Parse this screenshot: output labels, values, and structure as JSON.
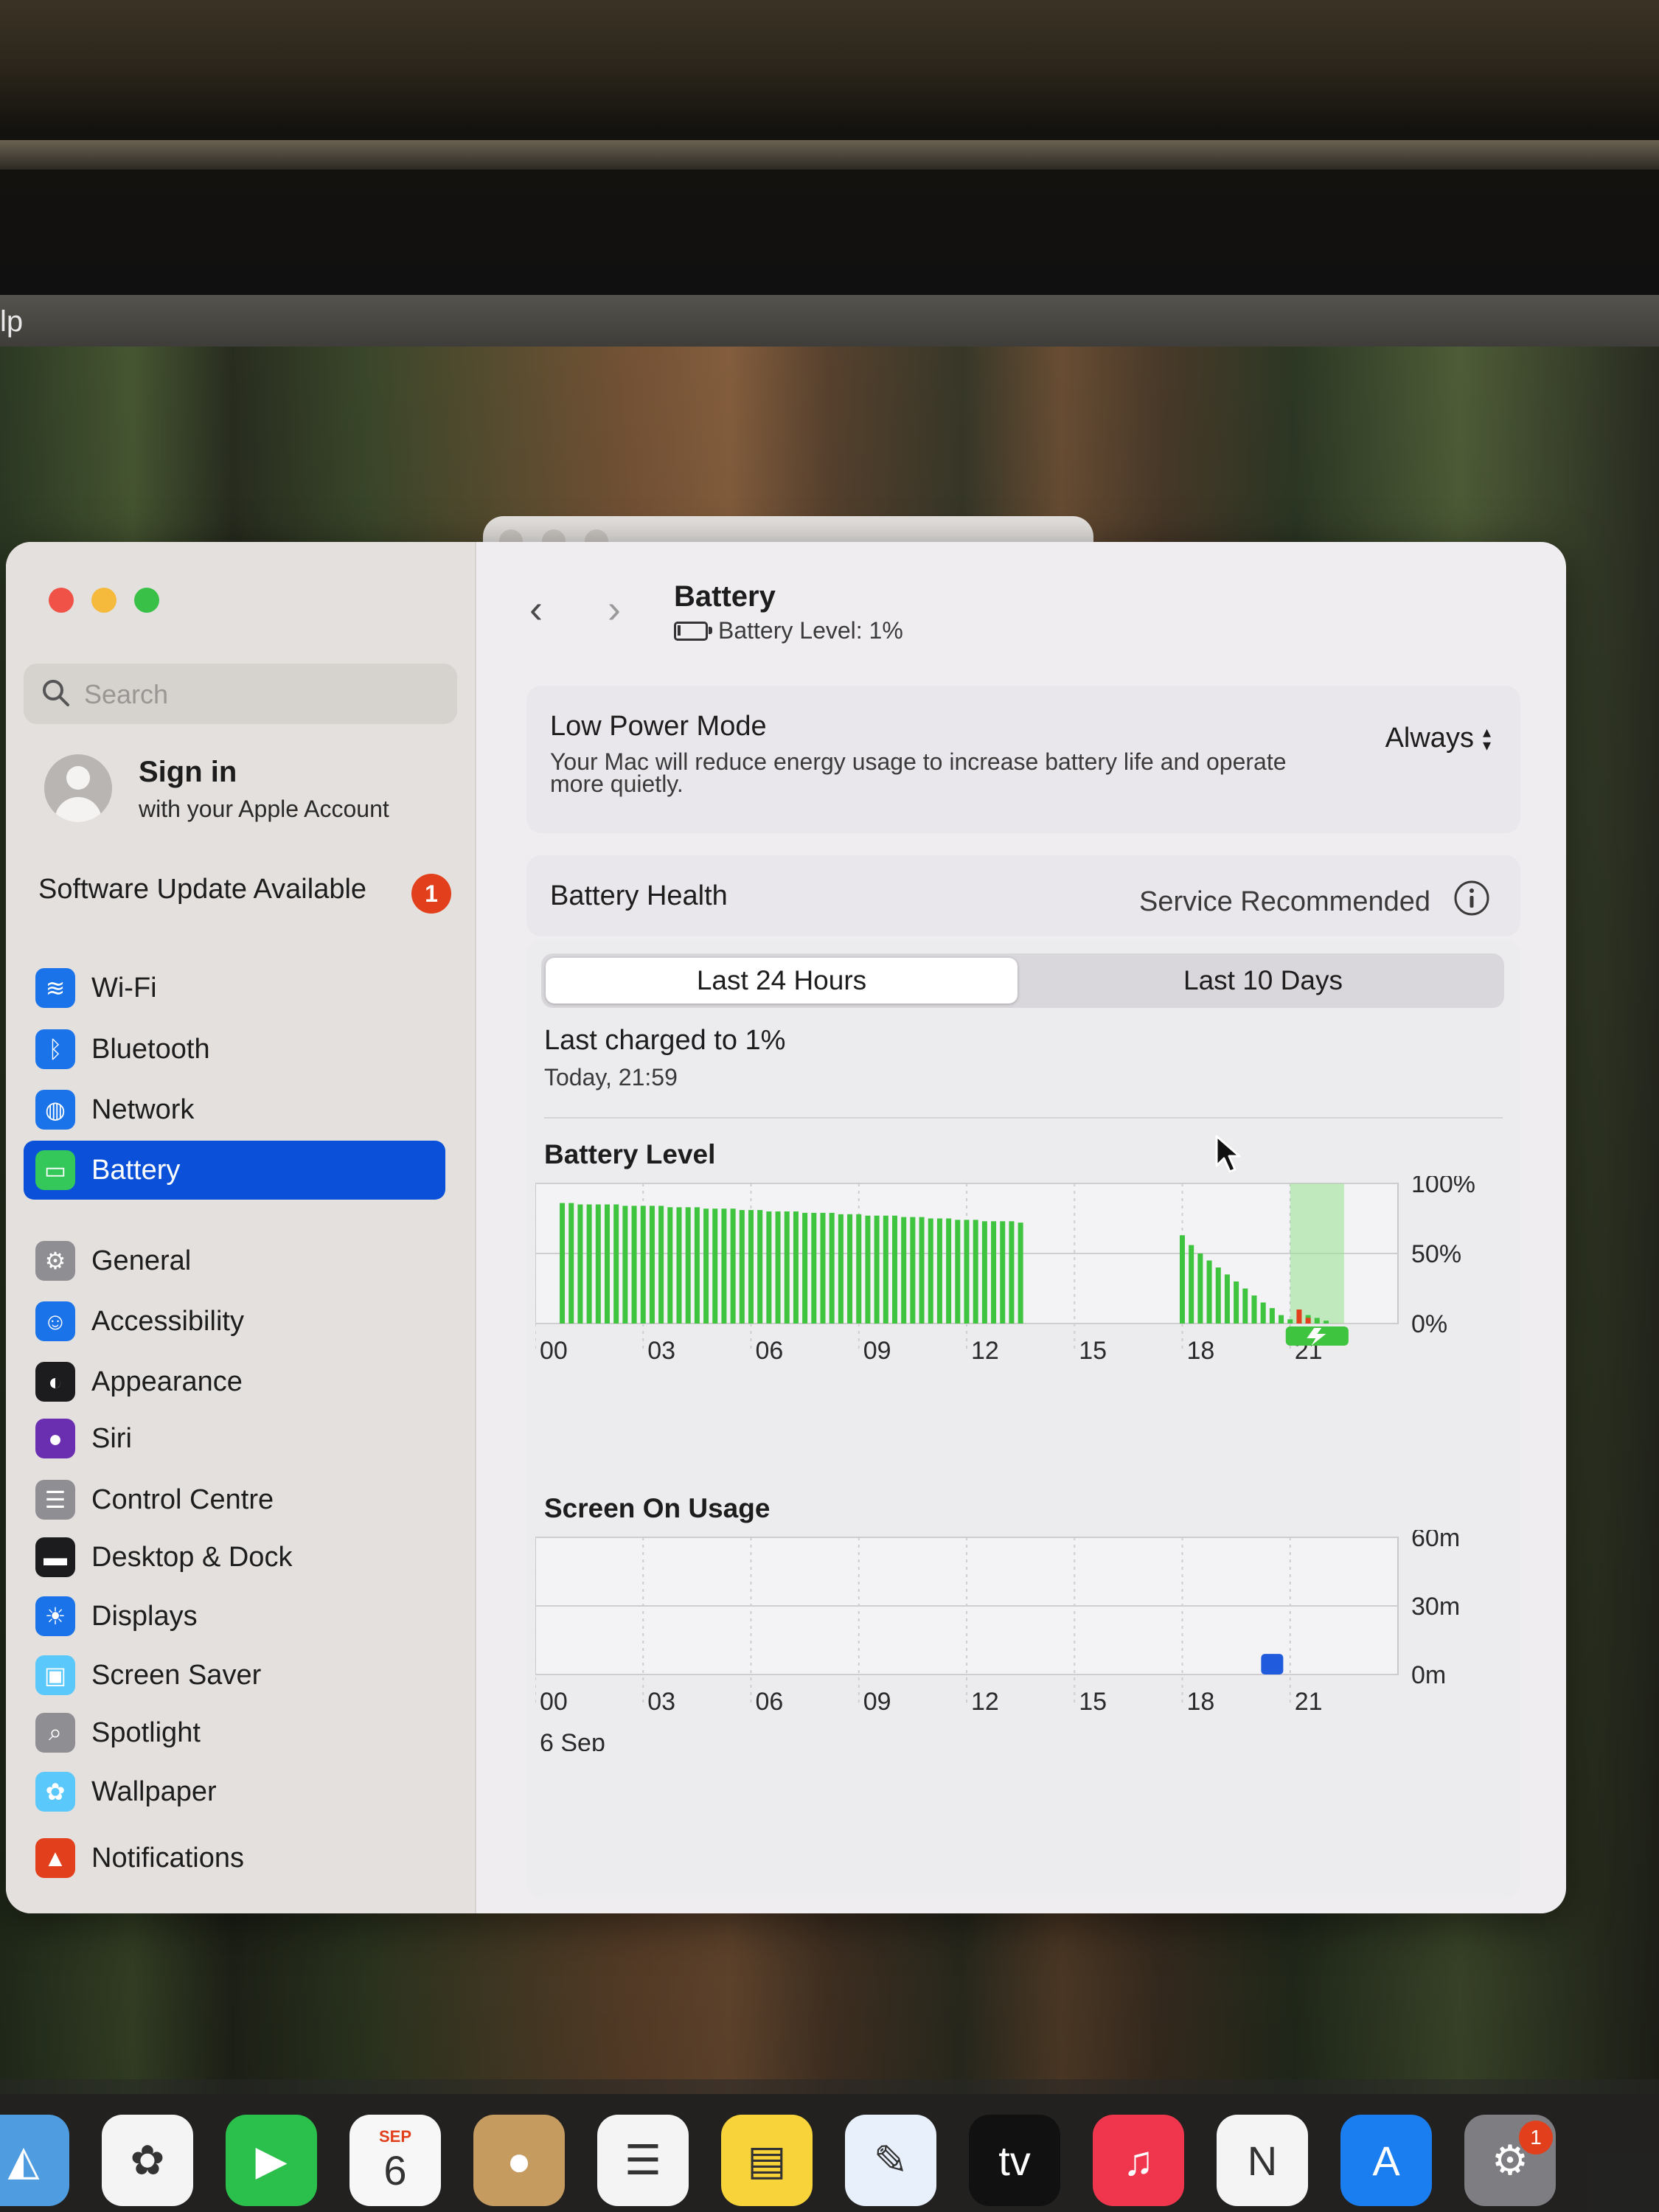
{
  "menubar": {
    "fragment": "lp"
  },
  "sidebar": {
    "search_placeholder": "Search",
    "account": {
      "title": "Sign in",
      "subtitle": "with your Apple Account"
    },
    "software_update": {
      "label": "Software Update Available",
      "count": "1"
    },
    "items": [
      {
        "label": "Wi-Fi",
        "icon": "wifi-icon",
        "color": "#1a73e8",
        "glyph": "≋"
      },
      {
        "label": "Bluetooth",
        "icon": "bluetooth-icon",
        "color": "#1a73e8",
        "glyph": "ᛒ"
      },
      {
        "label": "Network",
        "icon": "globe-icon",
        "color": "#1a73e8",
        "glyph": "◍"
      },
      {
        "label": "Battery",
        "icon": "battery-icon",
        "color": "#34c759",
        "glyph": "▭",
        "selected": true
      },
      {
        "label": "General",
        "icon": "gear-icon",
        "color": "#8e8e93",
        "glyph": "⚙"
      },
      {
        "label": "Accessibility",
        "icon": "accessibility-icon",
        "color": "#1a73e8",
        "glyph": "☺"
      },
      {
        "label": "Appearance",
        "icon": "appearance-icon",
        "color": "#1c1c1e",
        "glyph": "◐"
      },
      {
        "label": "Siri",
        "icon": "siri-icon",
        "color": "#6a2fb0",
        "glyph": "●"
      },
      {
        "label": "Control Centre",
        "icon": "control-centre-icon",
        "color": "#8e8e93",
        "glyph": "☰"
      },
      {
        "label": "Desktop & Dock",
        "icon": "desktop-dock-icon",
        "color": "#1c1c1e",
        "glyph": "▬"
      },
      {
        "label": "Displays",
        "icon": "displays-icon",
        "color": "#1a73e8",
        "glyph": "☀"
      },
      {
        "label": "Screen Saver",
        "icon": "screen-saver-icon",
        "color": "#5ac8fa",
        "glyph": "▣"
      },
      {
        "label": "Spotlight",
        "icon": "spotlight-icon",
        "color": "#8e8e93",
        "glyph": "⌕"
      },
      {
        "label": "Wallpaper",
        "icon": "wallpaper-icon",
        "color": "#5ac8fa",
        "glyph": "✿"
      },
      {
        "label": "Notifications",
        "icon": "notifications-icon",
        "color": "#e2401c",
        "glyph": "▲"
      }
    ]
  },
  "main": {
    "title": "Battery",
    "subtitle": "Battery Level: 1%",
    "low_power": {
      "title": "Low Power Mode",
      "description": "Your Mac will reduce energy usage to increase battery life and operate more quietly.",
      "value": "Always"
    },
    "health": {
      "title": "Battery Health",
      "value": "Service Recommended"
    },
    "tabs": [
      {
        "label": "Last 24 Hours",
        "active": true
      },
      {
        "label": "Last 10 Days",
        "active": false
      }
    ],
    "last_charged": {
      "title": "Last charged to 1%",
      "time": "Today, 21:59"
    }
  },
  "chart_data": [
    {
      "type": "bar",
      "title": "Battery Level",
      "x_ticks": [
        "00",
        "03",
        "06",
        "09",
        "12",
        "15",
        "18",
        "21"
      ],
      "y_ticks": [
        "100%",
        "50%",
        "0%"
      ],
      "ylim": [
        0,
        100
      ],
      "xlim": [
        0,
        24
      ],
      "charging_window": [
        21,
        22.5
      ],
      "grid": true,
      "series": [
        {
          "color": "#3ec43e",
          "x": [
            0.75,
            1.0,
            1.25,
            1.5,
            1.75,
            2.0,
            2.25,
            2.5,
            2.75,
            3.0,
            3.25,
            3.5,
            3.75,
            4.0,
            4.25,
            4.5,
            4.75,
            5.0,
            5.25,
            5.5,
            5.75,
            6.0,
            6.25,
            6.5,
            6.75,
            7.0,
            7.25,
            7.5,
            7.75,
            8.0,
            8.25,
            8.5,
            8.75,
            9.0,
            9.25,
            9.5,
            9.75,
            10.0,
            10.25,
            10.5,
            10.75,
            11.0,
            11.25,
            11.5,
            11.75,
            12.0,
            12.25,
            12.5,
            12.75,
            13.0,
            13.25,
            13.5,
            18.0,
            18.25,
            18.5,
            18.75,
            19.0,
            19.25,
            19.5,
            19.75,
            20.0,
            20.25,
            20.5,
            20.75,
            21.0,
            21.25,
            21.5,
            21.75,
            22.0
          ],
          "values": [
            86,
            86,
            85,
            85,
            85,
            85,
            85,
            84,
            84,
            84,
            84,
            84,
            83,
            83,
            83,
            83,
            82,
            82,
            82,
            82,
            81,
            81,
            81,
            80,
            80,
            80,
            80,
            79,
            79,
            79,
            79,
            78,
            78,
            78,
            77,
            77,
            77,
            77,
            76,
            76,
            76,
            75,
            75,
            75,
            74,
            74,
            74,
            73,
            73,
            73,
            73,
            72,
            63,
            56,
            50,
            45,
            40,
            35,
            30,
            25,
            20,
            15,
            11,
            6,
            3,
            2,
            6,
            4,
            2
          ]
        },
        {
          "color": "#e2401c",
          "x": [
            21.25,
            21.5
          ],
          "values": [
            10,
            4
          ]
        }
      ]
    },
    {
      "type": "bar",
      "title": "Screen On Usage",
      "x_ticks": [
        "00",
        "03",
        "06",
        "09",
        "12",
        "15",
        "18",
        "21"
      ],
      "y_ticks": [
        "60m",
        "30m",
        "0m"
      ],
      "ylim": [
        0,
        60
      ],
      "xlim": [
        0,
        24
      ],
      "date_label": "6 Sep",
      "grid": true,
      "series": [
        {
          "color": "#1f5bdc",
          "x": [
            20.5
          ],
          "values": [
            9
          ]
        }
      ]
    }
  ],
  "dock": {
    "items": [
      {
        "name": "maps-icon",
        "color": "#4f9de0",
        "glyph": "◭"
      },
      {
        "name": "photos-icon",
        "color": "#f4f4f4",
        "glyph": "✿"
      },
      {
        "name": "facetime-icon",
        "color": "#2bbf4b",
        "glyph": "▶"
      },
      {
        "name": "calendar-icon",
        "color": "#f7f7f7",
        "glyph": "6",
        "month": "SEP"
      },
      {
        "name": "contacts-icon",
        "color": "#c59b5f",
        "glyph": "●"
      },
      {
        "name": "reminders-icon",
        "color": "#f4f4f4",
        "glyph": "☰"
      },
      {
        "name": "notes-icon",
        "color": "#f9d33a",
        "glyph": "▤"
      },
      {
        "name": "freeform-icon",
        "color": "#e8f0fb",
        "glyph": "✎"
      },
      {
        "name": "apple-tv-icon",
        "color": "#111111",
        "glyph": "tv"
      },
      {
        "name": "music-icon",
        "color": "#f0364d",
        "glyph": "♫"
      },
      {
        "name": "news-icon",
        "color": "#f4f4f4",
        "glyph": "N"
      },
      {
        "name": "app-store-icon",
        "color": "#1b7ef0",
        "glyph": "A"
      },
      {
        "name": "system-settings-icon",
        "color": "#7d7d82",
        "glyph": "⚙"
      }
    ],
    "settings_badge": "1"
  }
}
